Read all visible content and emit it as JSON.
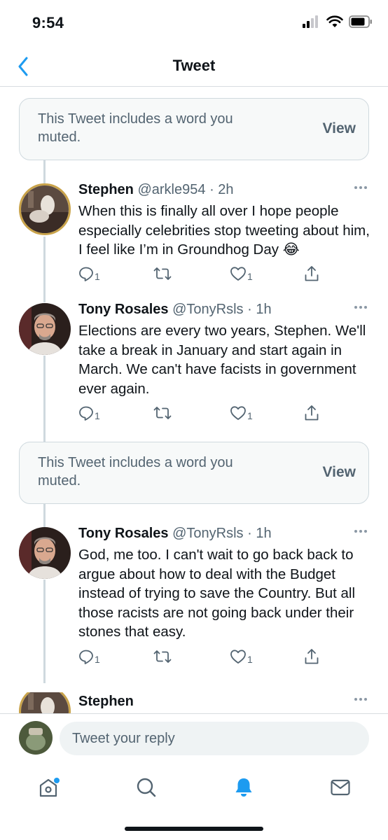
{
  "status_bar": {
    "time": "9:54"
  },
  "nav": {
    "title": "Tweet"
  },
  "muted_notices": [
    {
      "text": "This Tweet includes a word you muted.",
      "view_label": "View"
    },
    {
      "text": "This Tweet includes a word you muted.",
      "view_label": "View"
    }
  ],
  "tweets": [
    {
      "name": "Stephen",
      "handle": "@arkle954",
      "time": "· 2h",
      "text": "When this is finally all over I hope people especially celebrities stop tweeting about him, I feel like I’m in Groundhog Day 😂",
      "replies": "1",
      "retweets": "",
      "likes": "1"
    },
    {
      "name": "Tony Rosales",
      "handle": "@TonyRsls",
      "time": "· 1h",
      "text": "Elections are every two years, Stephen. We'll take a break in January and start again in March. We can't have facists in government ever again.",
      "replies": "1",
      "retweets": "",
      "likes": "1"
    },
    {
      "name": "Tony Rosales",
      "handle": "@TonyRsls",
      "time": "· 1h",
      "text": "God, me too. I can't wait to go back back to argue about how to deal with the Budget instead of trying to save the Country. But all those racists are not going back under their stones that easy.",
      "replies": "1",
      "retweets": "",
      "likes": "1"
    },
    {
      "name": "Stephen"
    }
  ],
  "reply_bar": {
    "placeholder": "Tweet your reply"
  },
  "tab_bar": {
    "items": [
      "home-icon",
      "search-icon",
      "notifications-icon",
      "messages-icon"
    ],
    "active": "notifications-icon",
    "accent": "#1d9bf0"
  },
  "colors": {
    "accent": "#1d9bf0",
    "secondary_text": "#536471",
    "thread_line": "#cfd9de"
  }
}
